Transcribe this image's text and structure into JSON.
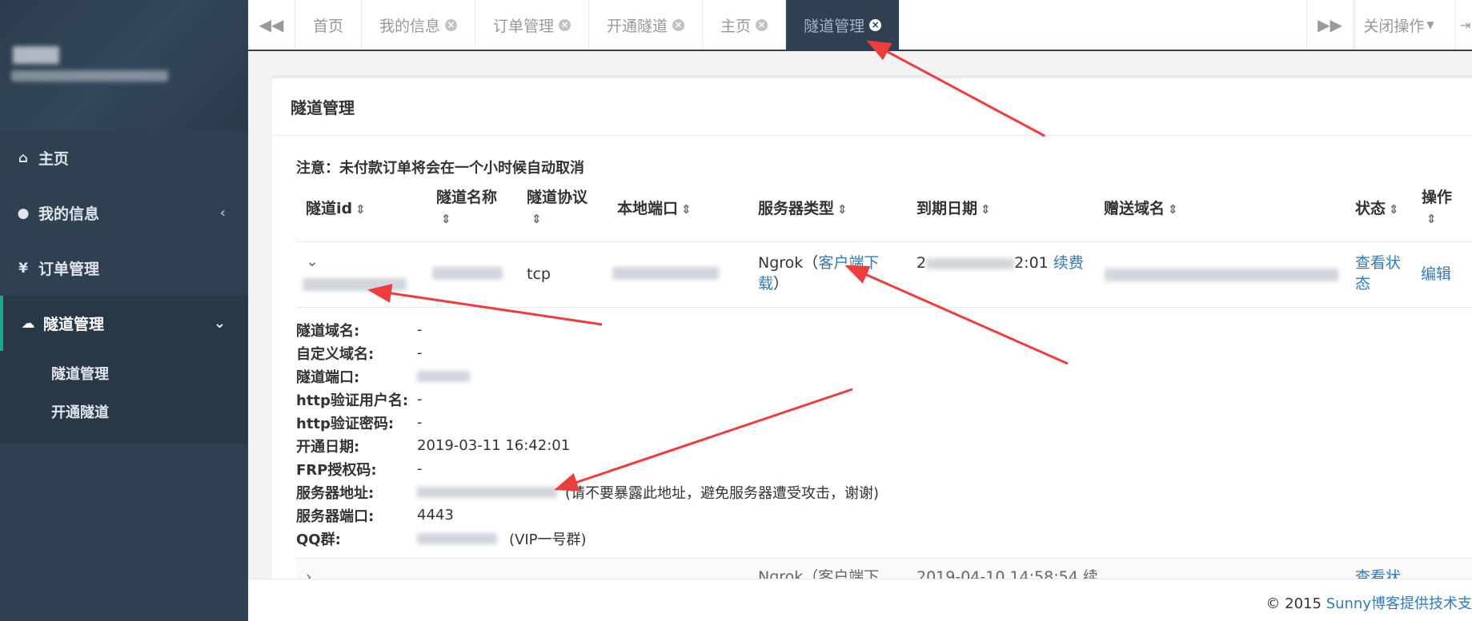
{
  "sidebar": {
    "nav": [
      {
        "icon": "home-icon",
        "glyph": "⌂",
        "label": "主页"
      },
      {
        "icon": "user-icon",
        "glyph": "●",
        "label": "我的信息"
      },
      {
        "icon": "yen-icon",
        "glyph": "¥",
        "label": "订单管理"
      },
      {
        "icon": "cloud-icon",
        "glyph": "☁",
        "label": "隧道管理"
      }
    ],
    "sub": [
      "隧道管理",
      "开通隧道"
    ]
  },
  "tabs": [
    "首页",
    "我的信息",
    "订单管理",
    "开通隧道",
    "主页",
    "隧道管理"
  ],
  "toolbar": {
    "close_ops": "关闭操作"
  },
  "panel": {
    "title": "隧道管理",
    "notice": "注意：未付款订单将会在一个小时候自动取消"
  },
  "table": {
    "headers": [
      "隧道id",
      "隧道名称",
      "隧道协议",
      "本地端口",
      "服务器类型",
      "到期日期",
      "赠送域名",
      "状态",
      "操作"
    ],
    "row": {
      "protocol": "tcp",
      "server_type": "Ngrok",
      "client_download": "客户端下载",
      "date_prefix": "2",
      "date_suffix": "2:01",
      "renew": "续费",
      "status_link": "查看状态",
      "edit_link": "编辑"
    }
  },
  "detail": [
    {
      "label": "隧道域名:",
      "value": "-"
    },
    {
      "label": "自定义域名:",
      "value": "-"
    },
    {
      "label": "隧道端口:",
      "value": ""
    },
    {
      "label": "http验证用户名:",
      "value": "-"
    },
    {
      "label": "http验证密码:",
      "value": "-"
    },
    {
      "label": "开通日期:",
      "value": "2019-03-11 16:42:01"
    },
    {
      "label": "FRP授权码:",
      "value": "-"
    },
    {
      "label": "服务器地址:",
      "value": "(请不要暴露此地址，避免服务器遭受攻击，谢谢)"
    },
    {
      "label": "服务器端口:",
      "value": "4443"
    },
    {
      "label": "QQ群:",
      "value": "(VIP一号群)"
    }
  ],
  "next_row": {
    "server_type": "Ngrok（客户端下",
    "date": "2019-04-10 14:58:54 续",
    "status": "查看状"
  },
  "footer": {
    "copyright": "© 2015 ",
    "link": "Sunny博客提供技术支"
  }
}
